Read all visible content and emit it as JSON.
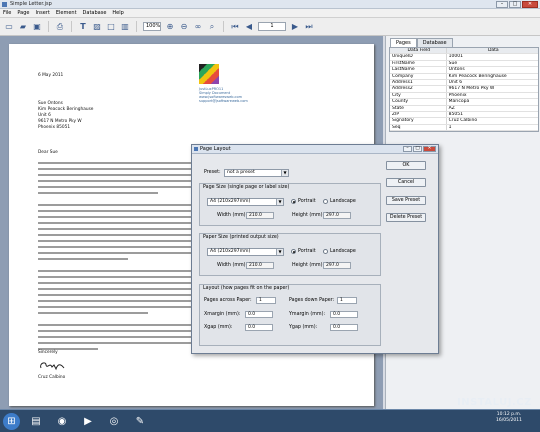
{
  "window": {
    "title": "Simple Letter.jsp"
  },
  "menu": [
    "File",
    "Page",
    "Insert",
    "Element",
    "Database",
    "Help"
  ],
  "toolbar": {
    "zoom": "100%",
    "page": "1"
  },
  "letter": {
    "date": "6 May 2011",
    "recipient": [
      "Sue Ontons",
      "Kim Peacock Beringhause",
      "Unit 6",
      "9617 N Metro Pky W",
      "Phoenix 85051"
    ],
    "company": [
      "JustLuxPRO11",
      "Simply Document",
      "www.jsoftwaresweb.com",
      "support@jsoftwareweb.com"
    ],
    "salutation": "Dear Sue",
    "closing": "Sincerely",
    "signature_name": "Cruz Calbino"
  },
  "panel": {
    "tabs": [
      "Pages",
      "Database"
    ],
    "headers": [
      "Data Field",
      "Data"
    ],
    "rows": [
      [
        "UniqueID",
        "10001"
      ],
      [
        "FirstName",
        "Sue"
      ],
      [
        "LastName",
        "Ontons"
      ],
      [
        "Company",
        "Kim Peacock Beringhause"
      ],
      [
        "Address1",
        "Unit 6"
      ],
      [
        "Address2",
        "9617 N Metro Pky W"
      ],
      [
        "City",
        "Phoenix"
      ],
      [
        "County",
        "Maricopa"
      ],
      [
        "State",
        "AZ"
      ],
      [
        "ZIP",
        "85051"
      ],
      [
        "Signatory",
        "Cruz Calbino"
      ],
      [
        "Seq",
        "1"
      ]
    ]
  },
  "dialog": {
    "title": "Page Layout",
    "preset_label": "Preset:",
    "preset_value": "not a preset",
    "page_size_title": "Page Size (single page or label size)",
    "page_size_value": "A4 (210x297mm)",
    "output_title": "Paper Size (printed output size)",
    "output_value": "A4 (210x297mm)",
    "portrait": "Portrait",
    "landscape": "Landscape",
    "width_label": "Width (mm):",
    "width_value": "210.0",
    "height_label": "Height (mm):",
    "height_value": "297.0",
    "layout_title": "Layout (how pages fit on the paper)",
    "across_label": "Pages across Paper:",
    "across_value": "1",
    "down_label": "Pages down Paper:",
    "down_value": "1",
    "xmargin_label": "Xmargin (mm):",
    "xmargin_value": "0.0",
    "ymargin_label": "Ymargin (mm):",
    "ymargin_value": "0.0",
    "xgap_label": "Xgap (mm):",
    "xgap_value": "0.0",
    "ygap_label": "Ygap (mm):",
    "ygap_value": "0.0",
    "buttons": {
      "ok": "OK",
      "cancel": "Cancel",
      "save": "Save Preset",
      "delete": "Delete Preset"
    }
  },
  "taskbar": {
    "time": "10:12 p.m.",
    "date": "16/05/2011"
  },
  "watermark": "INSTALUJ.CZ"
}
